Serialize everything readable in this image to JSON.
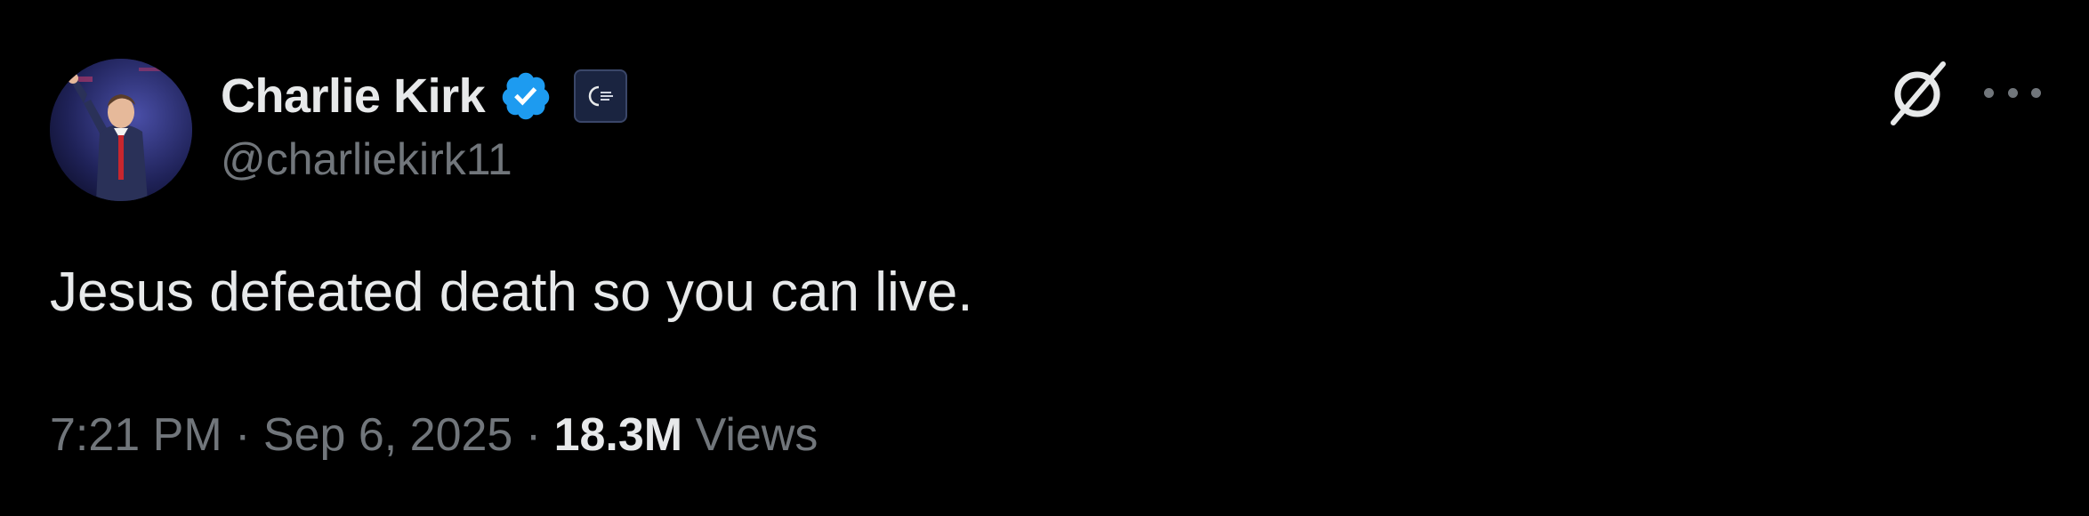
{
  "author": {
    "display_name": "Charlie Kirk",
    "handle": "@charliekirk11",
    "verified": true,
    "verified_color": "#1d9bf0",
    "avatar_icon": "profile-photo",
    "affiliate_icon": "organization-logo"
  },
  "tweet": {
    "text": "Jesus defeated death so you can live."
  },
  "meta": {
    "time": "7:21 PM",
    "separator": "·",
    "date": "Sep 6, 2025",
    "views_count": "18.3M",
    "views_label": "Views"
  },
  "actions": {
    "grok_icon": "grok-icon",
    "more_icon": "more-icon"
  },
  "colors": {
    "background": "#000000",
    "primary_text": "#e7e9ea",
    "secondary_text": "#71767b",
    "accent": "#1d9bf0"
  }
}
